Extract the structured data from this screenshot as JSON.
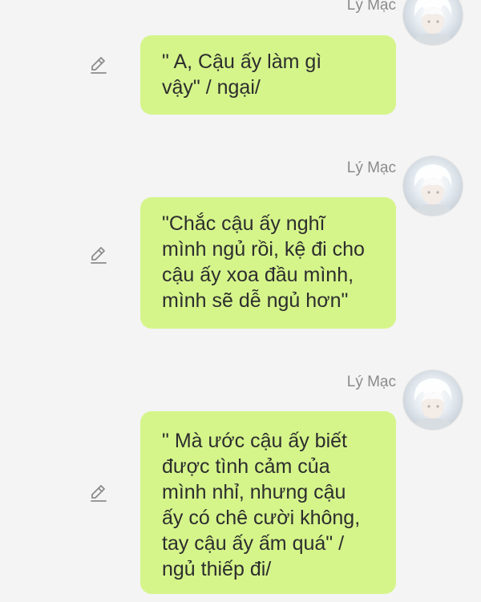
{
  "messages": [
    {
      "sender": "Lý Mạc",
      "text": "\" A, Cậu ấy làm gì\nvậy\" / ngại/"
    },
    {
      "sender": "Lý Mạc",
      "text": "\"Chắc cậu ấy nghĩ\nmình ngủ rồi, kệ đi cho\ncậu ấy xoa đầu mình,\nmình sẽ dễ ngủ hơn\""
    },
    {
      "sender": "Lý Mạc",
      "text": "\" Mà ước cậu ấy biết\nđược tình cảm của\nmình nhỉ, nhưng cậu\nấy có chê cười không,\ntay cậu ấy ấm quá\" /\nngủ thiếp đi/"
    }
  ],
  "icons": {
    "edit": "pencil-edit-icon",
    "avatar": "white-haired-character-avatar"
  },
  "colors": {
    "background": "#f4f4f4",
    "bubble": "#d5f58b",
    "sender_name": "#8a8a8a",
    "text": "#2d2d2d"
  }
}
